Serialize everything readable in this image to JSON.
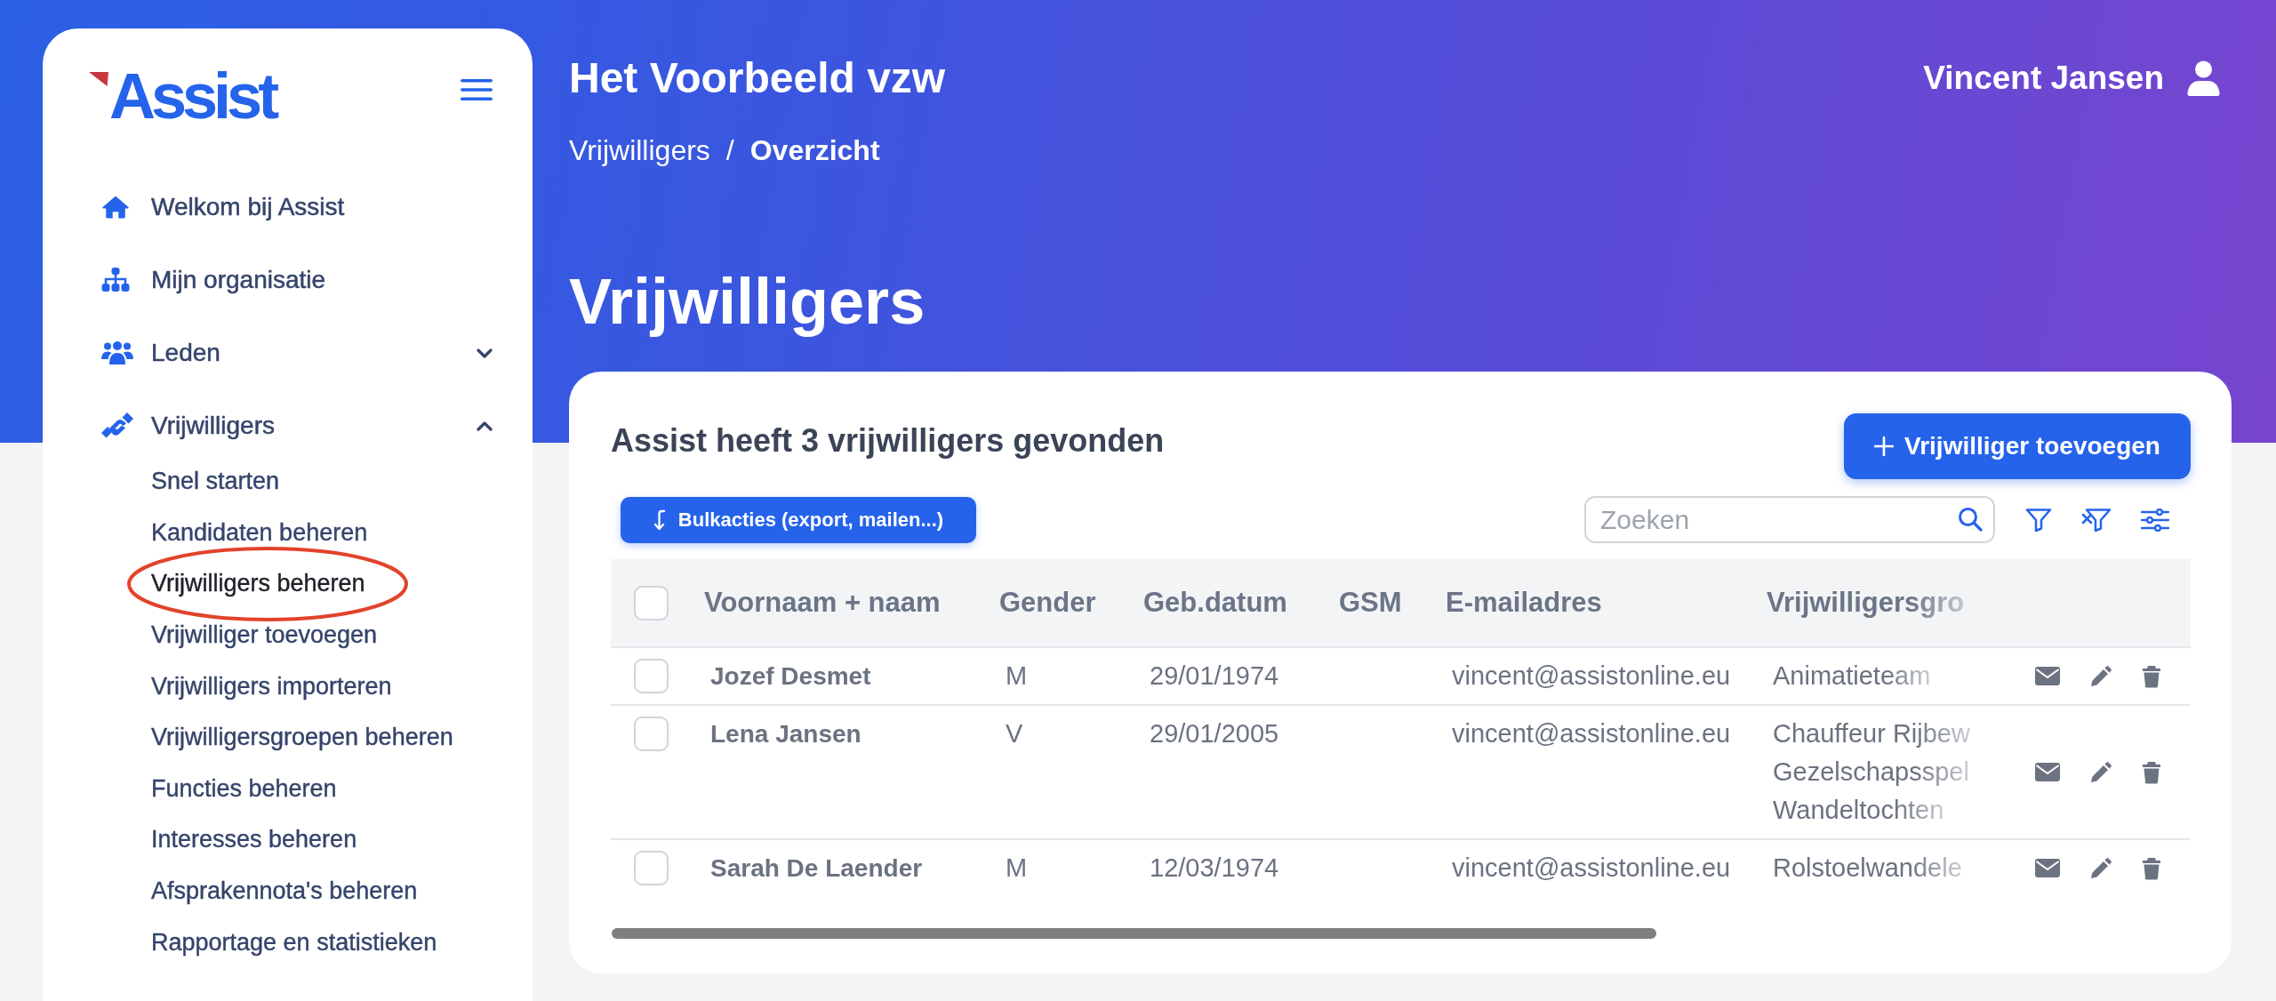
{
  "sidebar": {
    "logo": "Assist",
    "items": [
      {
        "kind": "link",
        "label": "Welkom bij Assist"
      },
      {
        "kind": "link",
        "label": "Mijn organisatie"
      },
      {
        "kind": "group",
        "label": "Leden",
        "expanded": false
      },
      {
        "kind": "group",
        "label": "Vrijwilligers",
        "expanded": true,
        "children": [
          {
            "label": "Snel starten",
            "selected": false,
            "circled": false
          },
          {
            "label": "Kandidaten beheren",
            "selected": false,
            "circled": false
          },
          {
            "label": "Vrijwilligers beheren",
            "selected": true,
            "circled": true
          },
          {
            "label": "Vrijwilliger toevoegen",
            "selected": false,
            "circled": false
          },
          {
            "label": "Vrijwilligers importeren",
            "selected": false,
            "circled": false
          },
          {
            "label": "Vrijwilligersgroepen beheren",
            "selected": false,
            "circled": false
          },
          {
            "label": "Functies beheren",
            "selected": false,
            "circled": false
          },
          {
            "label": "Interesses beheren",
            "selected": false,
            "circled": false
          },
          {
            "label": "Afsprakennota's beheren",
            "selected": false,
            "circled": false
          },
          {
            "label": "Rapportage en statistieken",
            "selected": false,
            "circled": false
          }
        ]
      }
    ]
  },
  "header": {
    "organization": "Het Voorbeeld vzw",
    "user": "Vincent Jansen"
  },
  "breadcrumb": {
    "separator": "/",
    "items": [
      {
        "label": "Vrijwilligers",
        "current": false
      },
      {
        "label": "Overzicht",
        "current": true
      }
    ]
  },
  "page_title": "Vrijwilligers",
  "results": {
    "title": "Assist heeft 3 vrijwilligers gevonden",
    "add_button": "Vrijwilliger toevoegen",
    "bulk_button": "Bulkacties (export, mailen...)",
    "search": {
      "placeholder": "Zoeken"
    }
  },
  "table": {
    "select_all": {
      "checked": false
    },
    "columns": [
      "Voornaam + naam",
      "Gender",
      "Geb.datum",
      "GSM",
      "E-mailadres",
      "Vrijwilligersgro"
    ],
    "rows": [
      {
        "checked": false,
        "name": "Jozef Desmet",
        "gender": "M",
        "birth_date": "29/01/1974",
        "email": "vincent@assistonline.eu",
        "groups": [
          "Animatieteam"
        ]
      },
      {
        "checked": false,
        "name": "Lena Jansen",
        "gender": "V",
        "birth_date": "29/01/2005",
        "email": "vincent@assistonline.eu",
        "groups": [
          "Chauffeur Rijbew",
          "Gezelschapsspel",
          "Wandeltochten"
        ]
      },
      {
        "checked": false,
        "name": "Sarah De Laender",
        "gender": "M",
        "birth_date": "12/03/1974",
        "email": "vincent@assistonline.eu",
        "groups": [
          "Rolstoelwandele"
        ]
      }
    ]
  }
}
